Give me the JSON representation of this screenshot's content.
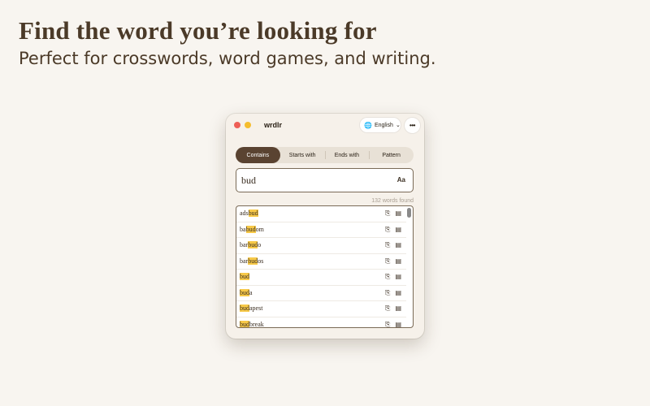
{
  "hero": {
    "title": "Find the word you’re looking for",
    "subtitle": "Perfect for crosswords, word games, and writing."
  },
  "window": {
    "app_name": "wrdlr",
    "language": {
      "icon": "translate-icon",
      "label": "English",
      "chevron": "⌄"
    },
    "more_label": "•••",
    "tabs": [
      {
        "label": "Contains",
        "active": true
      },
      {
        "label": "Starts with",
        "active": false
      },
      {
        "label": "Ends with",
        "active": false
      },
      {
        "label": "Pattern",
        "active": false
      }
    ],
    "search": {
      "value": "bud",
      "placeholder": "",
      "case_label": "Aa"
    },
    "count_text": "132 words found",
    "words": [
      {
        "pre": "ads",
        "match": "bud",
        "post": ""
      },
      {
        "pre": "ba",
        "match": "bud",
        "post": "om"
      },
      {
        "pre": "bar",
        "match": "bud",
        "post": "o"
      },
      {
        "pre": "bar",
        "match": "bud",
        "post": "os"
      },
      {
        "pre": "",
        "match": "bud",
        "post": ""
      },
      {
        "pre": "",
        "match": "bud",
        "post": "a"
      },
      {
        "pre": "",
        "match": "bud",
        "post": "apest"
      },
      {
        "pre": "",
        "match": "bud",
        "post": "break"
      }
    ]
  },
  "colors": {
    "background": "#f8f5f0",
    "accent": "#5a4331",
    "highlight": "#f7c948",
    "close": "#ee5f57",
    "minimize": "#f5bd2e"
  }
}
